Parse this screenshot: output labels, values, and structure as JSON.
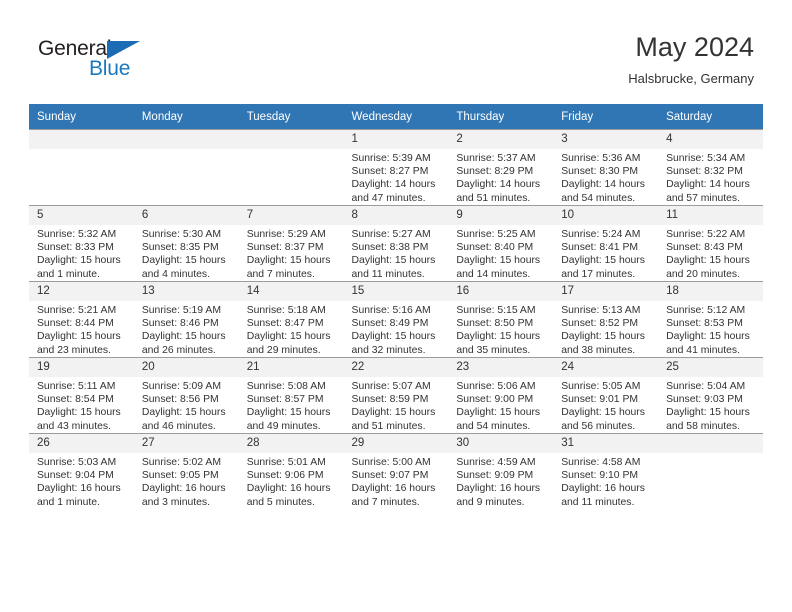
{
  "brand": {
    "logo_top": "General",
    "logo_bottom": "Blue",
    "triangle_icon": "blue-triangle-icon",
    "accent_color": "#1c79c0"
  },
  "header": {
    "month_title": "May 2024",
    "location": "Halsbrucke, Germany",
    "header_bg_color": "#3076b5",
    "daynum_bg_color": "#f2f2f2"
  },
  "calendar": {
    "weekday_headers": [
      "Sunday",
      "Monday",
      "Tuesday",
      "Wednesday",
      "Thursday",
      "Friday",
      "Saturday"
    ],
    "weeks": [
      [
        {
          "day": "",
          "empty": true,
          "sunrise": "",
          "sunset": "",
          "daylight_line1": "",
          "daylight_line2": ""
        },
        {
          "day": "",
          "empty": true,
          "sunrise": "",
          "sunset": "",
          "daylight_line1": "",
          "daylight_line2": ""
        },
        {
          "day": "",
          "empty": true,
          "sunrise": "",
          "sunset": "",
          "daylight_line1": "",
          "daylight_line2": ""
        },
        {
          "day": "1",
          "empty": false,
          "sunrise": "Sunrise: 5:39 AM",
          "sunset": "Sunset: 8:27 PM",
          "daylight_line1": "Daylight: 14 hours",
          "daylight_line2": "and 47 minutes."
        },
        {
          "day": "2",
          "empty": false,
          "sunrise": "Sunrise: 5:37 AM",
          "sunset": "Sunset: 8:29 PM",
          "daylight_line1": "Daylight: 14 hours",
          "daylight_line2": "and 51 minutes."
        },
        {
          "day": "3",
          "empty": false,
          "sunrise": "Sunrise: 5:36 AM",
          "sunset": "Sunset: 8:30 PM",
          "daylight_line1": "Daylight: 14 hours",
          "daylight_line2": "and 54 minutes."
        },
        {
          "day": "4",
          "empty": false,
          "sunrise": "Sunrise: 5:34 AM",
          "sunset": "Sunset: 8:32 PM",
          "daylight_line1": "Daylight: 14 hours",
          "daylight_line2": "and 57 minutes."
        }
      ],
      [
        {
          "day": "5",
          "empty": false,
          "sunrise": "Sunrise: 5:32 AM",
          "sunset": "Sunset: 8:33 PM",
          "daylight_line1": "Daylight: 15 hours",
          "daylight_line2": "and 1 minute."
        },
        {
          "day": "6",
          "empty": false,
          "sunrise": "Sunrise: 5:30 AM",
          "sunset": "Sunset: 8:35 PM",
          "daylight_line1": "Daylight: 15 hours",
          "daylight_line2": "and 4 minutes."
        },
        {
          "day": "7",
          "empty": false,
          "sunrise": "Sunrise: 5:29 AM",
          "sunset": "Sunset: 8:37 PM",
          "daylight_line1": "Daylight: 15 hours",
          "daylight_line2": "and 7 minutes."
        },
        {
          "day": "8",
          "empty": false,
          "sunrise": "Sunrise: 5:27 AM",
          "sunset": "Sunset: 8:38 PM",
          "daylight_line1": "Daylight: 15 hours",
          "daylight_line2": "and 11 minutes."
        },
        {
          "day": "9",
          "empty": false,
          "sunrise": "Sunrise: 5:25 AM",
          "sunset": "Sunset: 8:40 PM",
          "daylight_line1": "Daylight: 15 hours",
          "daylight_line2": "and 14 minutes."
        },
        {
          "day": "10",
          "empty": false,
          "sunrise": "Sunrise: 5:24 AM",
          "sunset": "Sunset: 8:41 PM",
          "daylight_line1": "Daylight: 15 hours",
          "daylight_line2": "and 17 minutes."
        },
        {
          "day": "11",
          "empty": false,
          "sunrise": "Sunrise: 5:22 AM",
          "sunset": "Sunset: 8:43 PM",
          "daylight_line1": "Daylight: 15 hours",
          "daylight_line2": "and 20 minutes."
        }
      ],
      [
        {
          "day": "12",
          "empty": false,
          "sunrise": "Sunrise: 5:21 AM",
          "sunset": "Sunset: 8:44 PM",
          "daylight_line1": "Daylight: 15 hours",
          "daylight_line2": "and 23 minutes."
        },
        {
          "day": "13",
          "empty": false,
          "sunrise": "Sunrise: 5:19 AM",
          "sunset": "Sunset: 8:46 PM",
          "daylight_line1": "Daylight: 15 hours",
          "daylight_line2": "and 26 minutes."
        },
        {
          "day": "14",
          "empty": false,
          "sunrise": "Sunrise: 5:18 AM",
          "sunset": "Sunset: 8:47 PM",
          "daylight_line1": "Daylight: 15 hours",
          "daylight_line2": "and 29 minutes."
        },
        {
          "day": "15",
          "empty": false,
          "sunrise": "Sunrise: 5:16 AM",
          "sunset": "Sunset: 8:49 PM",
          "daylight_line1": "Daylight: 15 hours",
          "daylight_line2": "and 32 minutes."
        },
        {
          "day": "16",
          "empty": false,
          "sunrise": "Sunrise: 5:15 AM",
          "sunset": "Sunset: 8:50 PM",
          "daylight_line1": "Daylight: 15 hours",
          "daylight_line2": "and 35 minutes."
        },
        {
          "day": "17",
          "empty": false,
          "sunrise": "Sunrise: 5:13 AM",
          "sunset": "Sunset: 8:52 PM",
          "daylight_line1": "Daylight: 15 hours",
          "daylight_line2": "and 38 minutes."
        },
        {
          "day": "18",
          "empty": false,
          "sunrise": "Sunrise: 5:12 AM",
          "sunset": "Sunset: 8:53 PM",
          "daylight_line1": "Daylight: 15 hours",
          "daylight_line2": "and 41 minutes."
        }
      ],
      [
        {
          "day": "19",
          "empty": false,
          "sunrise": "Sunrise: 5:11 AM",
          "sunset": "Sunset: 8:54 PM",
          "daylight_line1": "Daylight: 15 hours",
          "daylight_line2": "and 43 minutes."
        },
        {
          "day": "20",
          "empty": false,
          "sunrise": "Sunrise: 5:09 AM",
          "sunset": "Sunset: 8:56 PM",
          "daylight_line1": "Daylight: 15 hours",
          "daylight_line2": "and 46 minutes."
        },
        {
          "day": "21",
          "empty": false,
          "sunrise": "Sunrise: 5:08 AM",
          "sunset": "Sunset: 8:57 PM",
          "daylight_line1": "Daylight: 15 hours",
          "daylight_line2": "and 49 minutes."
        },
        {
          "day": "22",
          "empty": false,
          "sunrise": "Sunrise: 5:07 AM",
          "sunset": "Sunset: 8:59 PM",
          "daylight_line1": "Daylight: 15 hours",
          "daylight_line2": "and 51 minutes."
        },
        {
          "day": "23",
          "empty": false,
          "sunrise": "Sunrise: 5:06 AM",
          "sunset": "Sunset: 9:00 PM",
          "daylight_line1": "Daylight: 15 hours",
          "daylight_line2": "and 54 minutes."
        },
        {
          "day": "24",
          "empty": false,
          "sunrise": "Sunrise: 5:05 AM",
          "sunset": "Sunset: 9:01 PM",
          "daylight_line1": "Daylight: 15 hours",
          "daylight_line2": "and 56 minutes."
        },
        {
          "day": "25",
          "empty": false,
          "sunrise": "Sunrise: 5:04 AM",
          "sunset": "Sunset: 9:03 PM",
          "daylight_line1": "Daylight: 15 hours",
          "daylight_line2": "and 58 minutes."
        }
      ],
      [
        {
          "day": "26",
          "empty": false,
          "sunrise": "Sunrise: 5:03 AM",
          "sunset": "Sunset: 9:04 PM",
          "daylight_line1": "Daylight: 16 hours",
          "daylight_line2": "and 1 minute."
        },
        {
          "day": "27",
          "empty": false,
          "sunrise": "Sunrise: 5:02 AM",
          "sunset": "Sunset: 9:05 PM",
          "daylight_line1": "Daylight: 16 hours",
          "daylight_line2": "and 3 minutes."
        },
        {
          "day": "28",
          "empty": false,
          "sunrise": "Sunrise: 5:01 AM",
          "sunset": "Sunset: 9:06 PM",
          "daylight_line1": "Daylight: 16 hours",
          "daylight_line2": "and 5 minutes."
        },
        {
          "day": "29",
          "empty": false,
          "sunrise": "Sunrise: 5:00 AM",
          "sunset": "Sunset: 9:07 PM",
          "daylight_line1": "Daylight: 16 hours",
          "daylight_line2": "and 7 minutes."
        },
        {
          "day": "30",
          "empty": false,
          "sunrise": "Sunrise: 4:59 AM",
          "sunset": "Sunset: 9:09 PM",
          "daylight_line1": "Daylight: 16 hours",
          "daylight_line2": "and 9 minutes."
        },
        {
          "day": "31",
          "empty": false,
          "sunrise": "Sunrise: 4:58 AM",
          "sunset": "Sunset: 9:10 PM",
          "daylight_line1": "Daylight: 16 hours",
          "daylight_line2": "and 11 minutes."
        },
        {
          "day": "",
          "empty": true,
          "sunrise": "",
          "sunset": "",
          "daylight_line1": "",
          "daylight_line2": ""
        }
      ]
    ]
  }
}
